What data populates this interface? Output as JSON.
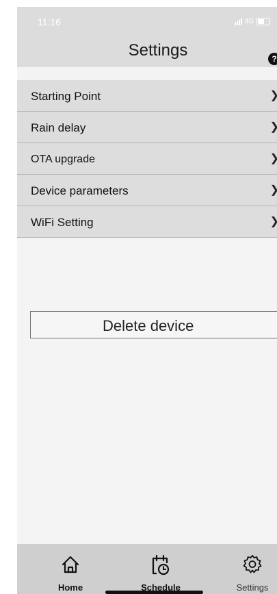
{
  "status_bar": {
    "time": "11:16",
    "network": "4G"
  },
  "header": {
    "title": "Settings",
    "help_glyph": "?"
  },
  "settings": {
    "items": [
      {
        "label": "Starting Point",
        "icon": "chevron-right-icon"
      },
      {
        "label": "Rain delay",
        "icon": "chevron-right-icon"
      },
      {
        "label": "OTA upgrade",
        "icon": "chevron-right-icon"
      },
      {
        "label": "Device parameters",
        "icon": "chevron-right-icon"
      },
      {
        "label": "WiFi Setting",
        "icon": "chevron-right-icon"
      }
    ]
  },
  "actions": {
    "delete_label": "Delete device"
  },
  "tabbar": {
    "tabs": [
      {
        "label": "Home",
        "icon": "home-icon"
      },
      {
        "label": "Schedule",
        "icon": "calendar-clock-icon"
      },
      {
        "label": "Settings",
        "icon": "gear-icon",
        "active": true
      }
    ]
  },
  "colors": {
    "header_bg": "#dcdcdc",
    "row_bg": "#dddddd",
    "page_bg": "#f4f4f4",
    "tabbar_bg": "#cfcfcf"
  }
}
